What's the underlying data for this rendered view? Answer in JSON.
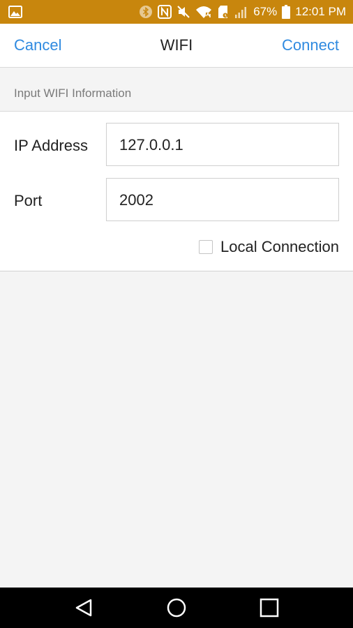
{
  "status_bar": {
    "battery_percent": "67%",
    "time": "12:01 PM",
    "colors": {
      "background": "#c8860d"
    },
    "icons": [
      "gallery-icon",
      "bluetooth-icon",
      "nfc-icon",
      "mute-icon",
      "wifi-icon",
      "sd-card-icon",
      "signal-icon",
      "battery-icon"
    ]
  },
  "nav": {
    "cancel_label": "Cancel",
    "title": "WIFI",
    "connect_label": "Connect",
    "accent_color": "#2f8ae0"
  },
  "section": {
    "header": "Input WIFI Information"
  },
  "form": {
    "ip_label": "IP Address",
    "ip_value": "127.0.0.1",
    "port_label": "Port",
    "port_value": "2002",
    "local_connection_label": "Local Connection",
    "local_connection_checked": false
  },
  "android_nav": {
    "icons": [
      "back-icon",
      "home-icon",
      "recents-icon"
    ]
  }
}
